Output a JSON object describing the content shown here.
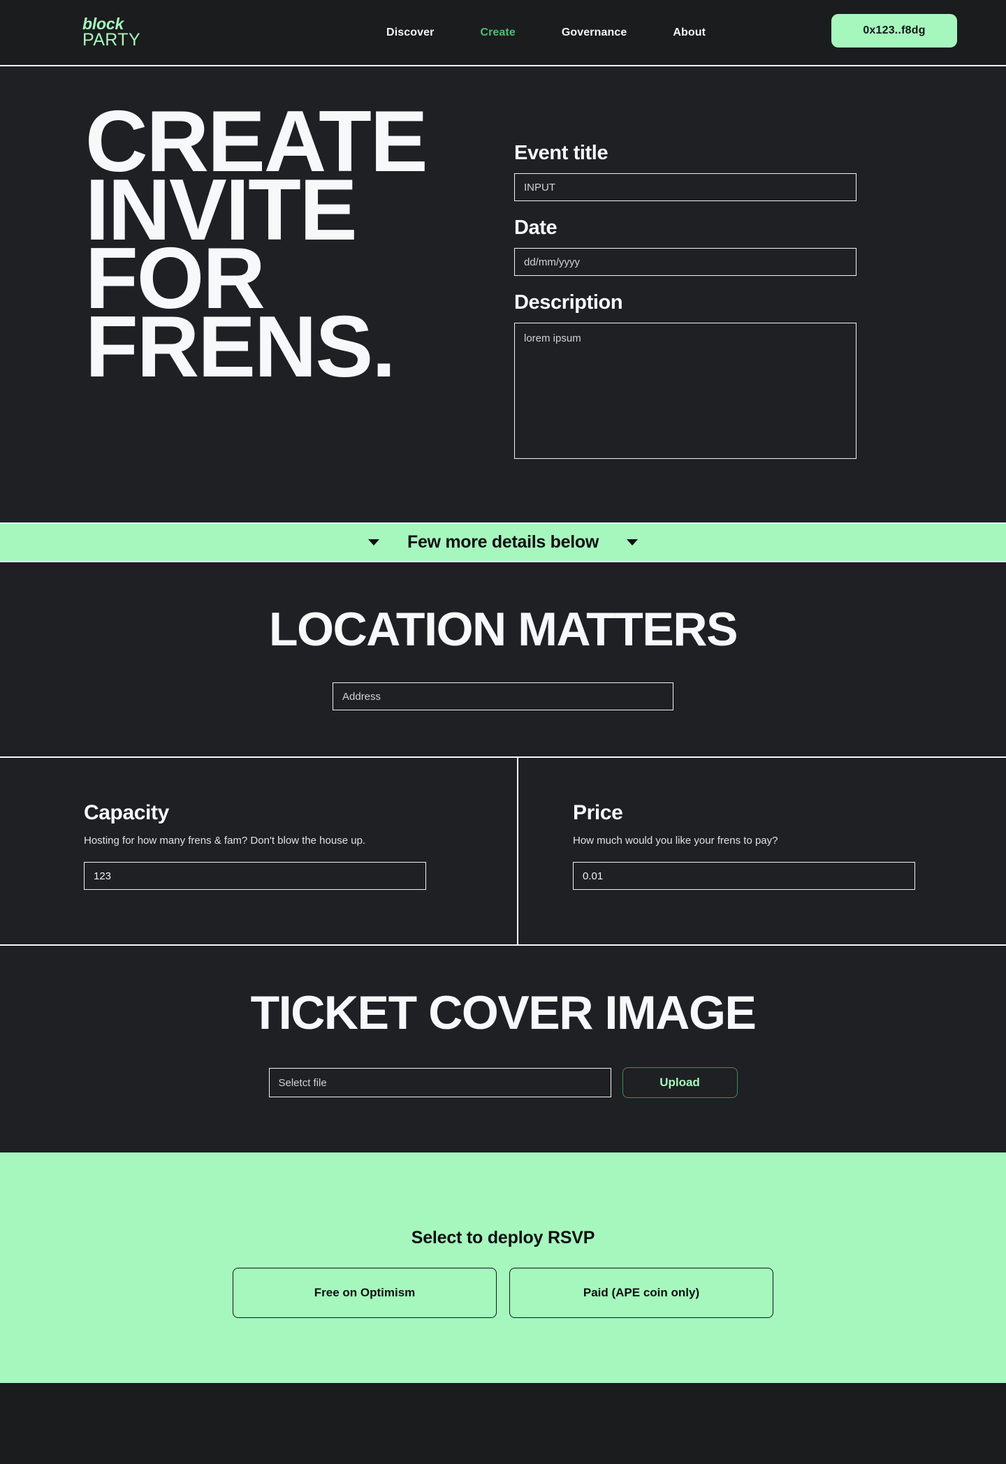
{
  "colors": {
    "background_dark": "#1e2023",
    "header_dark": "#1b1c1e",
    "accent_green": "#a6f7bd",
    "nav_active_green": "#4ebd72",
    "text_light": "#f7f8fa",
    "border_light": "#f0f2f4",
    "text_dark": "#0d0f12"
  },
  "header": {
    "logo": {
      "line1": "block",
      "line2": "PARTY"
    },
    "nav": [
      {
        "label": "Discover",
        "active": false
      },
      {
        "label": "Create",
        "active": true
      },
      {
        "label": "Governance",
        "active": false
      },
      {
        "label": "About",
        "active": false
      }
    ],
    "wallet_label": "0x123..f8dg"
  },
  "hero": {
    "title_lines": [
      "CREATE",
      "INVITE",
      "FOR",
      "FRENS."
    ],
    "form": {
      "event_title": {
        "label": "Event title",
        "placeholder": "INPUT",
        "value": ""
      },
      "date": {
        "label": "Date",
        "placeholder": "dd/mm/yyyy",
        "value": ""
      },
      "description": {
        "label": "Description",
        "placeholder": "lorem ipsum",
        "value": ""
      }
    }
  },
  "banner": {
    "text": "Few more details below",
    "left_icon": "chevron-down-icon",
    "right_icon": "chevron-down-icon"
  },
  "location": {
    "heading": "LOCATION MATTERS",
    "address": {
      "placeholder": "Address",
      "value": ""
    }
  },
  "capacity": {
    "title": "Capacity",
    "subtitle": "Hosting for how many frens & fam? Don't blow the house up.",
    "value": "123",
    "placeholder": "123"
  },
  "price": {
    "title": "Price",
    "subtitle": "How much would you like your frens to pay?",
    "value": "0.01",
    "placeholder": "0.01"
  },
  "ticket": {
    "heading": "TICKET COVER IMAGE",
    "file_placeholder": "Seletct file",
    "file_value": "",
    "upload_label": "Upload"
  },
  "rsvp": {
    "title": "Select to deploy RSVP",
    "options": [
      {
        "label": "Free on Optimism"
      },
      {
        "label": "Paid (APE coin only)"
      }
    ]
  }
}
